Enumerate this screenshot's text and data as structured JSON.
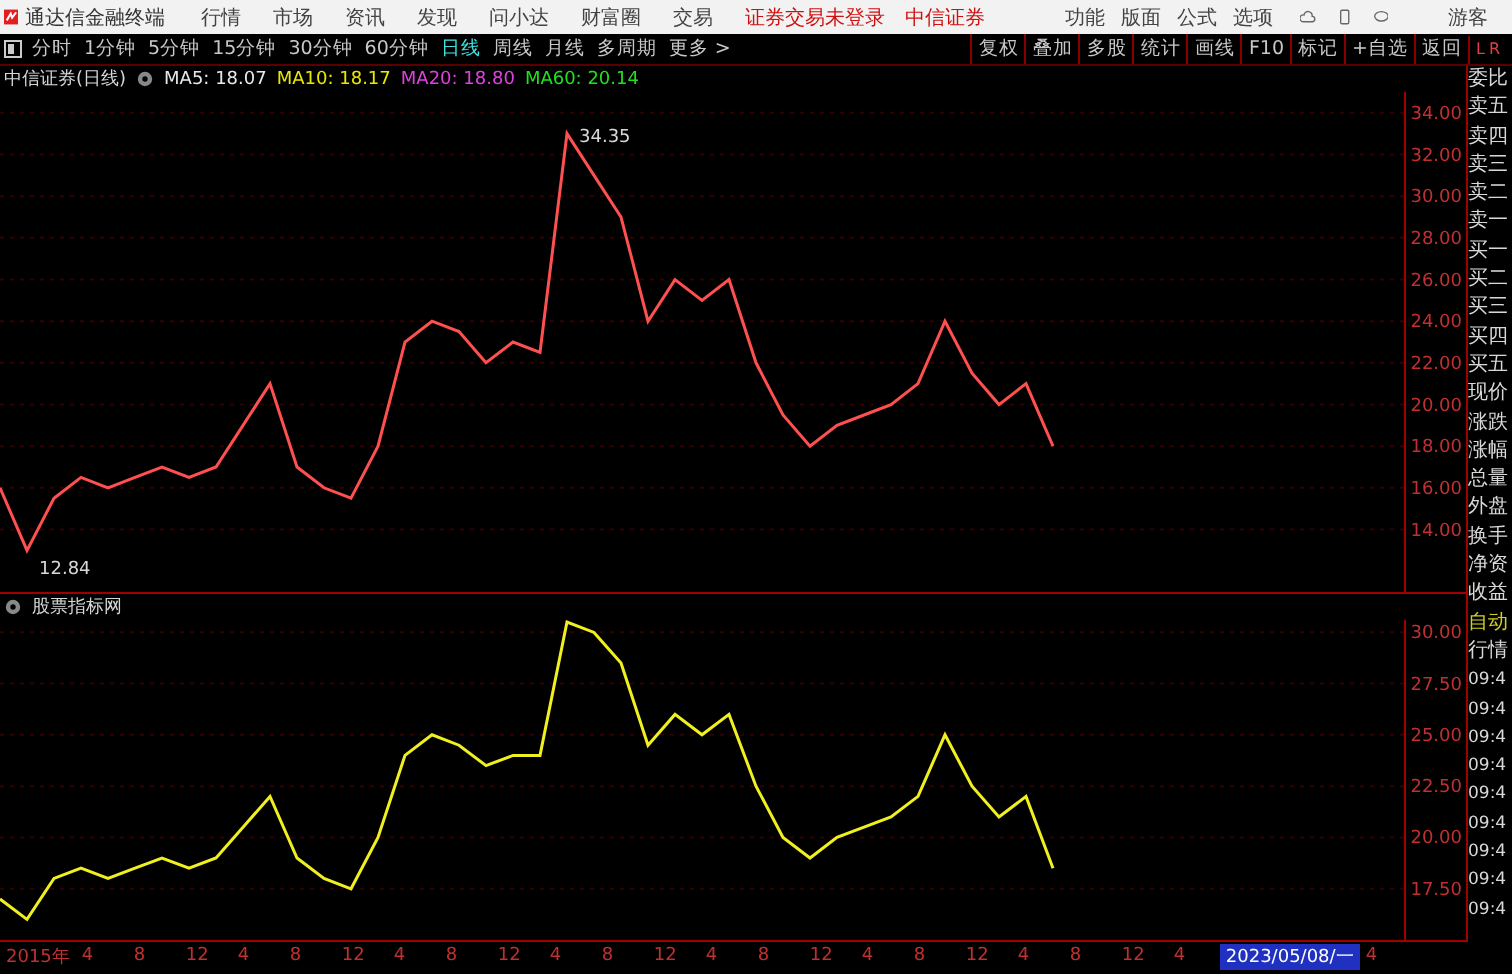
{
  "menu_bar": {
    "app_title": "通达信金融终端",
    "menus": [
      "行情",
      "市场",
      "资讯",
      "发现",
      "问小达",
      "财富圈",
      "交易"
    ],
    "login_status": "证券交易未登录",
    "broker": "中信证券",
    "tools": [
      "功能",
      "版面",
      "公式",
      "选项"
    ],
    "user": "游客"
  },
  "period_bar": {
    "periods": [
      {
        "label": "分时",
        "selected": false
      },
      {
        "label": "1分钟",
        "selected": false
      },
      {
        "label": "5分钟",
        "selected": false
      },
      {
        "label": "15分钟",
        "selected": false
      },
      {
        "label": "30分钟",
        "selected": false
      },
      {
        "label": "60分钟",
        "selected": false
      },
      {
        "label": "日线",
        "selected": true
      },
      {
        "label": "周线",
        "selected": false
      },
      {
        "label": "月线",
        "selected": false
      },
      {
        "label": "多周期",
        "selected": false
      }
    ],
    "more": "更多 >",
    "actions": [
      "复权",
      "叠加",
      "多股",
      "统计",
      "画线",
      "F10",
      "标记",
      "+自选",
      "返回"
    ]
  },
  "price_pane": {
    "title": "中信证券(日线)",
    "indicators": [
      {
        "label": "MA5: 18.07",
        "color": "#e8e8e8"
      },
      {
        "label": "MA10: 18.17",
        "color": "#e8e800"
      },
      {
        "label": "MA20: 18.80",
        "color": "#e040e0"
      },
      {
        "label": "MA60: 20.14",
        "color": "#20e020"
      }
    ],
    "high_label": "34.35",
    "low_label": "12.84",
    "chart_data": {
      "type": "line",
      "grid": true,
      "ylim": [
        11,
        35
      ],
      "yticks": [
        {
          "value": 14,
          "label": "14.00"
        },
        {
          "value": 16,
          "label": "16.00"
        },
        {
          "value": 18,
          "label": "18.00"
        },
        {
          "value": 20,
          "label": "20.00"
        },
        {
          "value": 22,
          "label": "22.00"
        },
        {
          "value": 24,
          "label": "24.00"
        },
        {
          "value": 26,
          "label": "26.00"
        },
        {
          "value": 28,
          "label": "28.00"
        },
        {
          "value": 30,
          "label": "30.00"
        },
        {
          "value": 32,
          "label": "32.00"
        },
        {
          "value": 34,
          "label": "34.00"
        }
      ],
      "values": [
        16,
        13,
        15.5,
        16.5,
        16,
        16.5,
        17,
        16.5,
        17,
        19,
        21,
        17,
        16,
        15.5,
        18,
        23,
        24,
        23.5,
        22,
        23,
        22.5,
        33,
        31,
        29,
        24,
        26,
        25,
        26,
        22,
        19.5,
        18,
        19,
        19.5,
        20,
        21,
        24,
        21.5,
        20,
        21,
        18
      ]
    }
  },
  "indicator_pane": {
    "title": "股票指标网",
    "chart_data": {
      "type": "line",
      "grid": true,
      "ylim": [
        15,
        30.6
      ],
      "yticks": [
        {
          "value": 17.5,
          "label": "17.50"
        },
        {
          "value": 20,
          "label": "20.00"
        },
        {
          "value": 22.5,
          "label": "22.50"
        },
        {
          "value": 25,
          "label": "25.00"
        },
        {
          "value": 27.5,
          "label": "27.50"
        },
        {
          "value": 30,
          "label": "30.00"
        }
      ],
      "values": [
        17,
        16,
        18,
        18.5,
        18,
        18.5,
        19,
        18.5,
        19,
        20.5,
        22,
        19,
        18,
        17.5,
        20,
        24,
        25,
        24.5,
        23.5,
        24,
        24,
        30.5,
        30,
        28.5,
        24.5,
        26,
        25,
        26,
        22.5,
        20,
        19,
        20,
        20.5,
        21,
        22,
        25,
        22.5,
        21,
        22,
        18.5
      ]
    }
  },
  "x_axis": {
    "labels": [
      {
        "label": "2015年",
        "selected": false
      },
      {
        "label": "4",
        "selected": false
      },
      {
        "label": "8",
        "selected": false
      },
      {
        "label": "12",
        "selected": false
      },
      {
        "label": "4",
        "selected": false
      },
      {
        "label": "8",
        "selected": false
      },
      {
        "label": "12",
        "selected": false
      },
      {
        "label": "4",
        "selected": false
      },
      {
        "label": "8",
        "selected": false
      },
      {
        "label": "12",
        "selected": false
      },
      {
        "label": "4",
        "selected": false
      },
      {
        "label": "8",
        "selected": false
      },
      {
        "label": "12",
        "selected": false
      },
      {
        "label": "4",
        "selected": false
      },
      {
        "label": "8",
        "selected": false
      },
      {
        "label": "12",
        "selected": false
      },
      {
        "label": "4",
        "selected": false
      },
      {
        "label": "8",
        "selected": false
      },
      {
        "label": "12",
        "selected": false
      },
      {
        "label": "4",
        "selected": false
      },
      {
        "label": "8",
        "selected": false
      },
      {
        "label": "12",
        "selected": false
      },
      {
        "label": "4",
        "selected": false
      },
      {
        "label": "2023/05/08/一",
        "selected": true
      },
      {
        "label": "4",
        "selected": false
      }
    ]
  },
  "side_panel": {
    "corner": [
      "L",
      "R"
    ],
    "quote_labels": [
      "委比",
      "卖五",
      "卖四",
      "卖三",
      "卖二",
      "卖一",
      "买一",
      "买二",
      "买三",
      "买四",
      "买五",
      "现价",
      "涨跌",
      "涨幅",
      "总量",
      "外盘",
      "换手",
      "净资",
      "收益"
    ],
    "mode_labels": [
      "自动",
      "行情"
    ],
    "tick_times": [
      "09:4",
      "09:4",
      "09:4",
      "09:4",
      "09:4",
      "09:4",
      "09:4",
      "09:4",
      "09:4"
    ]
  }
}
